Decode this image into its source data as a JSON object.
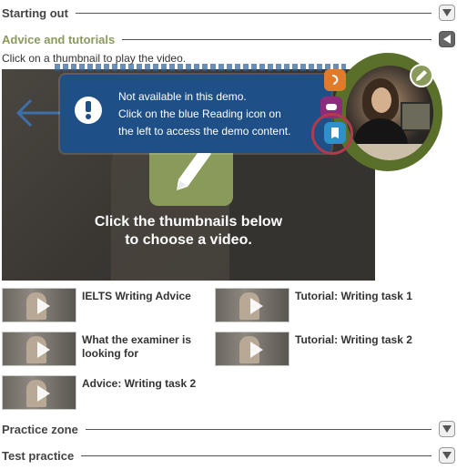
{
  "sections": {
    "starting_out": "Starting out",
    "advice_tutorials": "Advice and tutorials",
    "practice_zone": "Practice zone",
    "test_practice": "Test practice"
  },
  "instruction": "Click on a thumbnail to play the video.",
  "video": {
    "caption_line1": "Click the thumbnails below",
    "caption_line2": "to choose a video."
  },
  "popup": {
    "line1": "Not available in this demo.",
    "line2": "Click on the blue Reading icon on",
    "line3": "the left to access the demo content."
  },
  "thumbnails": [
    {
      "label": "IELTS Writing Advice"
    },
    {
      "label": "Tutorial: Writing task 1"
    },
    {
      "label": "What the examiner is looking for"
    },
    {
      "label": "Tutorial: Writing task 2"
    },
    {
      "label": "Advice: Writing task 2"
    }
  ],
  "colors": {
    "accent_green": "#8a9a5b",
    "popup_blue": "#1e4f86",
    "highlight_red": "#b23a4e"
  },
  "icons": {
    "collapsed_toggle": "chevron-down-icon",
    "expanded_toggle": "chevron-left-icon",
    "info": "info-icon",
    "pencil": "pencil-icon"
  }
}
